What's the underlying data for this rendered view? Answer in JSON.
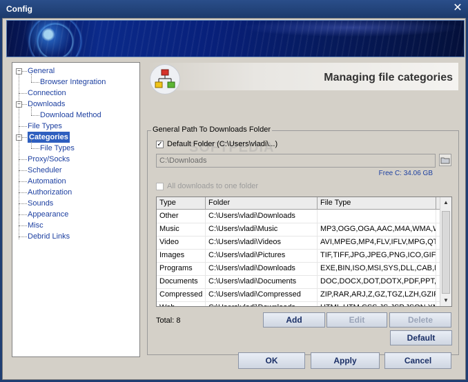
{
  "window": {
    "title": "Config"
  },
  "tree": {
    "items": [
      {
        "label": "General",
        "level": 0,
        "selected": false
      },
      {
        "label": "Browser Integration",
        "level": 1,
        "selected": false
      },
      {
        "label": "Connection",
        "level": 0,
        "selected": false
      },
      {
        "label": "Downloads",
        "level": 0,
        "selected": false
      },
      {
        "label": "Download Method",
        "level": 1,
        "selected": false
      },
      {
        "label": "File Types",
        "level": 0,
        "selected": false
      },
      {
        "label": "Categories",
        "level": 0,
        "selected": true
      },
      {
        "label": "File Types",
        "level": 1,
        "selected": false
      },
      {
        "label": "Proxy/Socks",
        "level": 0,
        "selected": false
      },
      {
        "label": "Scheduler",
        "level": 0,
        "selected": false
      },
      {
        "label": "Automation",
        "level": 0,
        "selected": false
      },
      {
        "label": "Authorization",
        "level": 0,
        "selected": false
      },
      {
        "label": "Sounds",
        "level": 0,
        "selected": false
      },
      {
        "label": "Appearance",
        "level": 0,
        "selected": false
      },
      {
        "label": "Misc",
        "level": 0,
        "selected": false
      },
      {
        "label": "Debrid Links",
        "level": 0,
        "selected": false
      }
    ]
  },
  "header": {
    "title": "Managing file categories",
    "icon": "categories-icon"
  },
  "group": {
    "title": "General Path To Downloads Folder",
    "default_folder_label": "Default Folder (C:\\Users\\vladi\\...)",
    "default_folder_checked": true,
    "path_value": "C:\\Downloads",
    "free_space": "Free C: 34.06 GB",
    "all_one_folder_label": "All downloads to one folder",
    "all_one_folder_checked": false
  },
  "table": {
    "columns": [
      "Type",
      "Folder",
      "File Type"
    ],
    "rows": [
      [
        "Other",
        "C:\\Users\\vladi\\Downloads",
        ""
      ],
      [
        "Music",
        "C:\\Users\\vladi\\Music",
        "MP3,OGG,OGA,AAC,M4A,WMA,WI"
      ],
      [
        "Video",
        "C:\\Users\\vladi\\Videos",
        "AVI,MPEG,MP4,FLV,IFLV,MPG,QT,I"
      ],
      [
        "Images",
        "C:\\Users\\vladi\\Pictures",
        "TIF,TIFF,JPG,JPEG,PNG,ICO,GIF,T"
      ],
      [
        "Programs",
        "C:\\Users\\vladi\\Downloads",
        "EXE,BIN,ISO,MSI,SYS,DLL,CAB,MS"
      ],
      [
        "Documents",
        "C:\\Users\\vladi\\Documents",
        "DOC,DOCX,DOT,DOTX,PDF,PPT,XI"
      ],
      [
        "Compressed",
        "C:\\Users\\vladi\\Compressed",
        "ZIP,RAR,ARJ,Z,GZ,TGZ,LZH,GZIP,"
      ],
      [
        "Web",
        "C:\\Users\\vladi\\Downloads",
        "HTML,HTM,CSS,JS,JSP,JSON,XML"
      ]
    ]
  },
  "total_label": "Total: 8",
  "buttons": {
    "add": "Add",
    "edit": "Edit",
    "delete": "Delete",
    "default": "Default",
    "ok": "OK",
    "apply": "Apply",
    "cancel": "Cancel"
  },
  "watermark": "SOFTPEDIA",
  "colors": {
    "selection": "#2e5fbf",
    "link_text": "#1c3fa0",
    "title_bar": "#1f3e73"
  }
}
